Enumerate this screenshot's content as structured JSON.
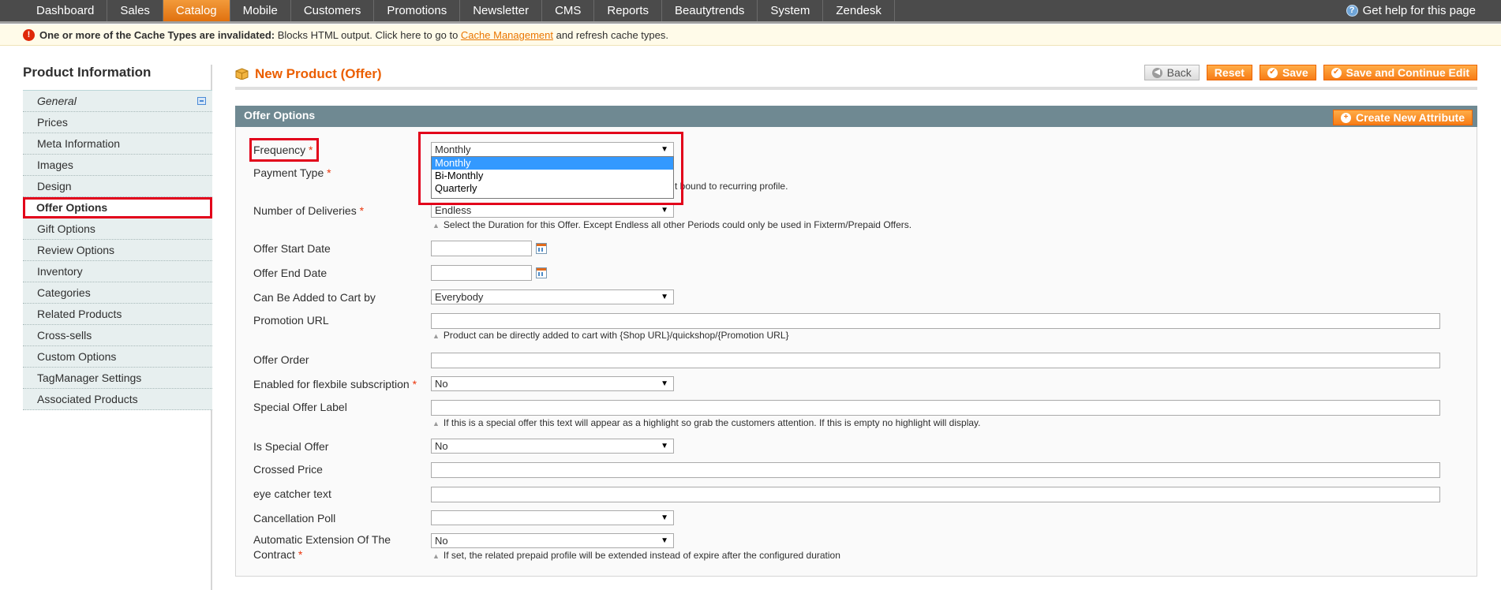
{
  "nav": {
    "items": [
      "Dashboard",
      "Sales",
      "Catalog",
      "Mobile",
      "Customers",
      "Promotions",
      "Newsletter",
      "CMS",
      "Reports",
      "Beautytrends",
      "System",
      "Zendesk"
    ],
    "active": "Catalog",
    "help": "Get help for this page"
  },
  "notice": {
    "bold": "One or more of the Cache Types are invalidated:",
    "text1": " Blocks HTML output. Click here to go to ",
    "link": "Cache Management",
    "text2": " and refresh cache types."
  },
  "sidebar": {
    "title": "Product Information",
    "tabs": [
      "General",
      "Prices",
      "Meta Information",
      "Images",
      "Design",
      "Offer Options",
      "Gift Options",
      "Review Options",
      "Inventory",
      "Categories",
      "Related Products",
      "Cross-sells",
      "Custom Options",
      "TagManager Settings",
      "Associated Products"
    ],
    "active": "Offer Options"
  },
  "header": {
    "title": "New Product (Offer)",
    "back": "Back",
    "reset": "Reset",
    "save": "Save",
    "save_continue": "Save and Continue Edit"
  },
  "fieldset": {
    "legend": "Offer Options",
    "create_attribute": "Create New Attribute"
  },
  "form": {
    "frequency": {
      "label": "Frequency",
      "value": "Monthly",
      "options": [
        "Monthly",
        "Bi-Monthly",
        "Quarterly"
      ]
    },
    "payment_type": {
      "label": "Payment Type",
      "note_visible": "t bound to recurring profile."
    },
    "number_of_deliveries": {
      "label": "Number of Deliveries",
      "value": "Endless",
      "note": "Select the Duration for this Offer. Except Endless all other Periods could only be used in Fixterm/Prepaid Offers."
    },
    "offer_start_date": {
      "label": "Offer Start Date",
      "value": ""
    },
    "offer_end_date": {
      "label": "Offer End Date",
      "value": ""
    },
    "added_to_cart_by": {
      "label": "Can Be Added to Cart by",
      "value": "Everybody"
    },
    "promotion_url": {
      "label": "Promotion URL",
      "value": "",
      "note": "Product can be directly added to cart with {Shop URL}/quickshop/{Promotion URL}"
    },
    "offer_order": {
      "label": "Offer Order",
      "value": ""
    },
    "flexible_subscription": {
      "label": "Enabled for flexbile subscription",
      "value": "No"
    },
    "special_offer_label": {
      "label": "Special Offer Label",
      "value": "",
      "note": "If this is a special offer this text will appear as a highlight so grab the customers attention. If this is empty no highlight will display."
    },
    "is_special_offer": {
      "label": "Is Special Offer",
      "value": "No"
    },
    "crossed_price": {
      "label": "Crossed Price",
      "value": ""
    },
    "eye_catcher": {
      "label": "eye catcher text",
      "value": ""
    },
    "cancellation_poll": {
      "label": "Cancellation Poll",
      "value": ""
    },
    "auto_extension": {
      "label_line1": "Automatic Extension Of The",
      "label_line2": "Contract",
      "value": "No",
      "note": "If set, the related prepaid profile will be extended instead of expire after the configured duration"
    },
    "required_mark": "*"
  }
}
